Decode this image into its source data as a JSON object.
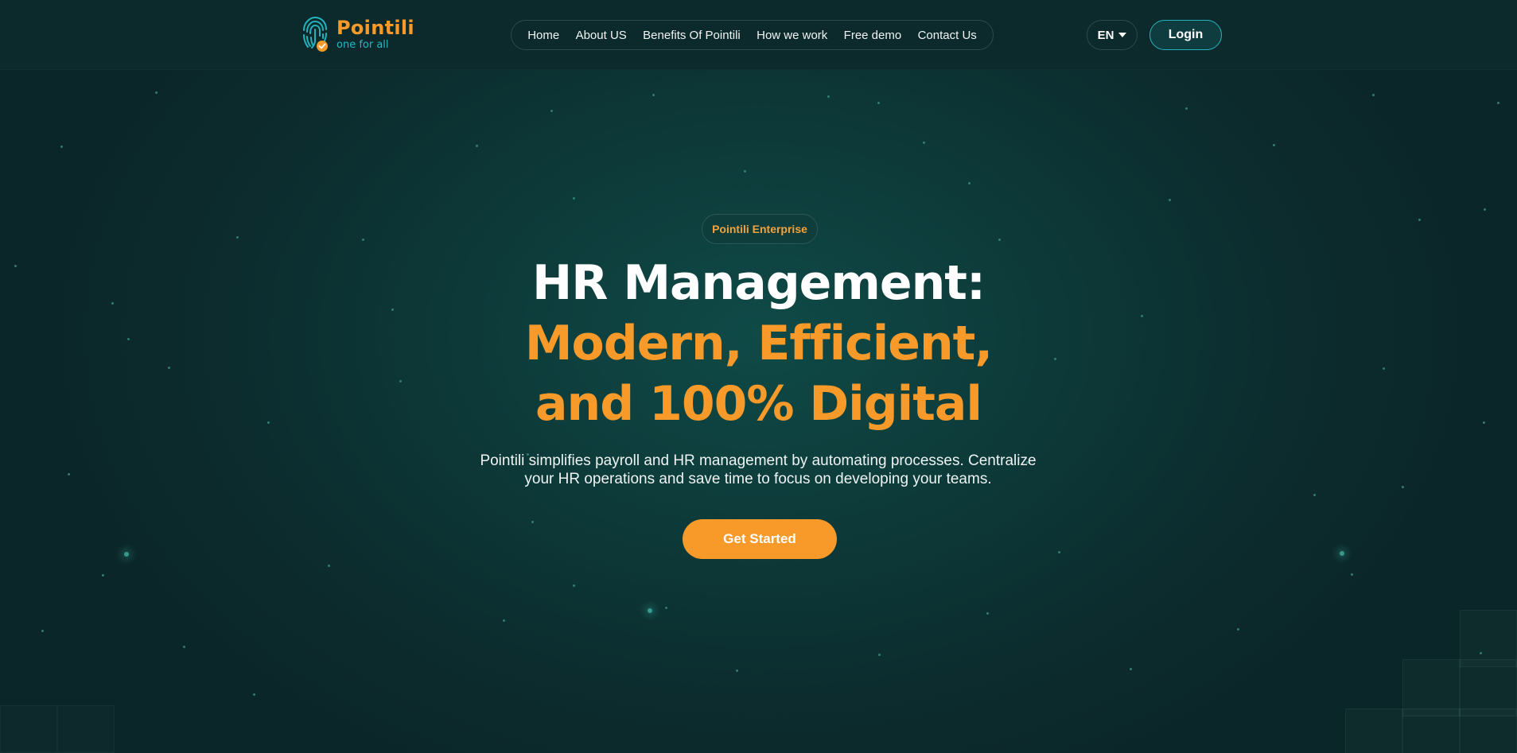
{
  "brand": {
    "name": "Pointili",
    "tagline": "one for all",
    "colors": {
      "accent": "#f79a2a",
      "teal": "#23b3bf",
      "background": "#0c2c2e"
    }
  },
  "nav": {
    "items": [
      {
        "label": "Home"
      },
      {
        "label": "About US"
      },
      {
        "label": "Benefits Of Pointili"
      },
      {
        "label": "How we work"
      },
      {
        "label": "Free demo"
      },
      {
        "label": "Contact Us"
      }
    ]
  },
  "header": {
    "language": "EN",
    "login_label": "Login"
  },
  "hero": {
    "badge": "Pointili Enterprise",
    "title_line1": "HR Management:",
    "title_line2": "Modern, Efficient,",
    "title_line3": "and 100% Digital",
    "subtitle_line1": "Pointili simplifies payroll and HR management by automating processes. Centralize",
    "subtitle_line2": "your HR operations and save time to focus on developing your teams.",
    "cta_label": "Get Started"
  },
  "icons": {
    "logo": "fingerprint-check-icon",
    "language_caret": "chevron-down-icon"
  }
}
